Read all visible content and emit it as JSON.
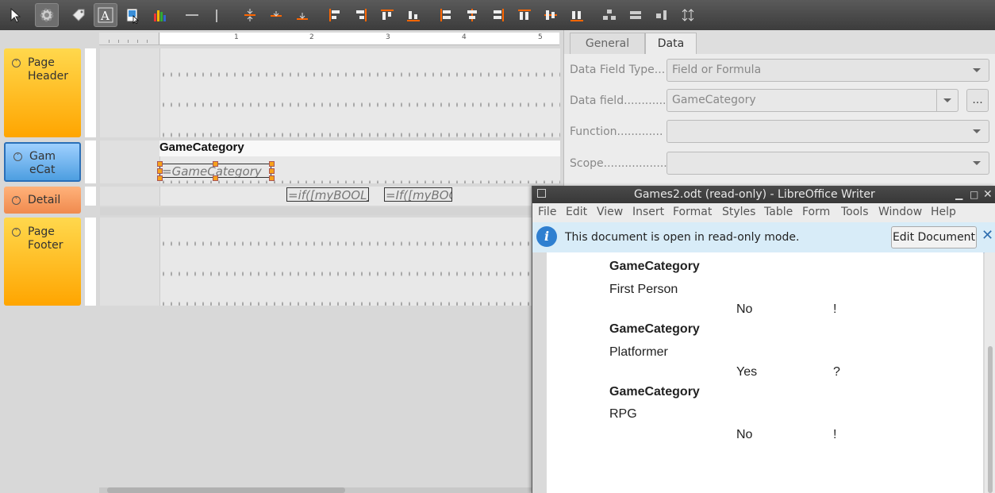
{
  "toolbar": {
    "icons": [
      "select-pointer-icon",
      "gear-icon",
      "tag-label-icon",
      "text-field-icon",
      "image-icon",
      "chart-icon",
      "horizontal-line-icon",
      "vertical-line-icon",
      "align-center-vertical-icon",
      "align-top-edge-icon",
      "align-bottom-edge-icon",
      "align-left-icon",
      "align-right-icon",
      "align-top-icon",
      "align-bottom-icon",
      "align-left-to-section-icon",
      "align-center-horizontal-icon",
      "align-right-to-section-icon",
      "align-top-to-section-icon",
      "align-middle-to-section-icon",
      "align-bottom-to-section-icon",
      "shrink-icon",
      "shrink-horizontal-icon",
      "shrink-vertical-icon",
      "stretch-icon"
    ]
  },
  "ruler": {
    "marks": [
      "1",
      "2",
      "3",
      "4",
      "5"
    ]
  },
  "sections": {
    "page_header": "Page\nHeader",
    "group": "Gam\neCat",
    "detail": "Detail",
    "page_footer": "Page\nFooter"
  },
  "report": {
    "group_label": "GameCategory",
    "group_field": "=GameCategory",
    "detail_field_1": "=if([myBOOL];",
    "detail_field_2": "=If([myBOO"
  },
  "properties": {
    "tabs": [
      "General",
      "Data"
    ],
    "active_tab": "Data",
    "data_field_type_label": "Data Field Type...",
    "data_field_type_value": "Field or Formula",
    "data_field_label": "Data field............",
    "data_field_value": "GameCategory",
    "browse_button": "...",
    "function_label": "Function.............",
    "scope_label": "Scope..................."
  },
  "writer": {
    "title": "Games2.odt (read-only) - LibreOffice Writer",
    "menu": [
      "File",
      "Edit",
      "View",
      "Insert",
      "Format",
      "Styles",
      "Table",
      "Form",
      "Tools",
      "Window",
      "Help"
    ],
    "infobar_text": "This document is open in read-only mode.",
    "edit_button": "Edit Document",
    "rows": [
      {
        "header": "GameCategory",
        "category": "First Person",
        "value": "No",
        "mark": "!"
      },
      {
        "header": "GameCategory",
        "category": "Platformer",
        "value": "Yes",
        "mark": "?"
      },
      {
        "header": "GameCategory",
        "category": "RPG",
        "value": "No",
        "mark": "!"
      }
    ]
  }
}
